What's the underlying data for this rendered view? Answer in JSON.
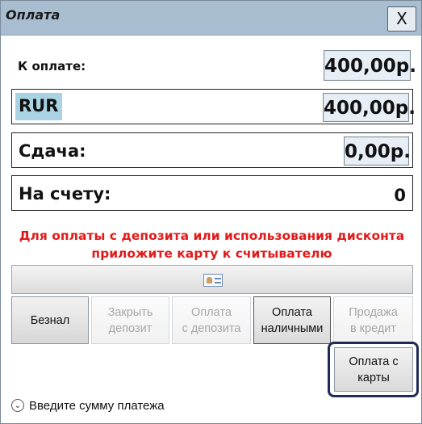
{
  "window": {
    "title": "Оплата",
    "close_label": "X"
  },
  "to_pay": {
    "label": "К оплате:",
    "amount": "400,00р."
  },
  "currency": {
    "label": "RUR",
    "amount": "400,00р."
  },
  "change": {
    "label": "Сдача:",
    "amount": "0,00р."
  },
  "account": {
    "label": "На счету:",
    "amount": "0"
  },
  "notice": {
    "line1": "Для оплаты с депозита или использования дисконта",
    "line2": "приложите карту к считывателю"
  },
  "buttons": {
    "cashless": "Безнал",
    "close_deposit_1": "Закрыть",
    "close_deposit_2": "депозит",
    "pay_deposit_1": "Оплата",
    "pay_deposit_2": "с депозита",
    "pay_cash_1": "Оплата",
    "pay_cash_2": "наличными",
    "credit_sale_1": "Продажа",
    "credit_sale_2": "в кредит",
    "pay_card_1": "Оплата с",
    "pay_card_2": "карты"
  },
  "hint": {
    "text": "Введите сумму платежа",
    "icon": "chevron-down-circle-icon"
  },
  "colors": {
    "titlebar": "#a9bdd1",
    "notice": "#e11b1b",
    "currency_highlight": "#a9d3e3",
    "focus_ring": "#1f2a5a"
  }
}
